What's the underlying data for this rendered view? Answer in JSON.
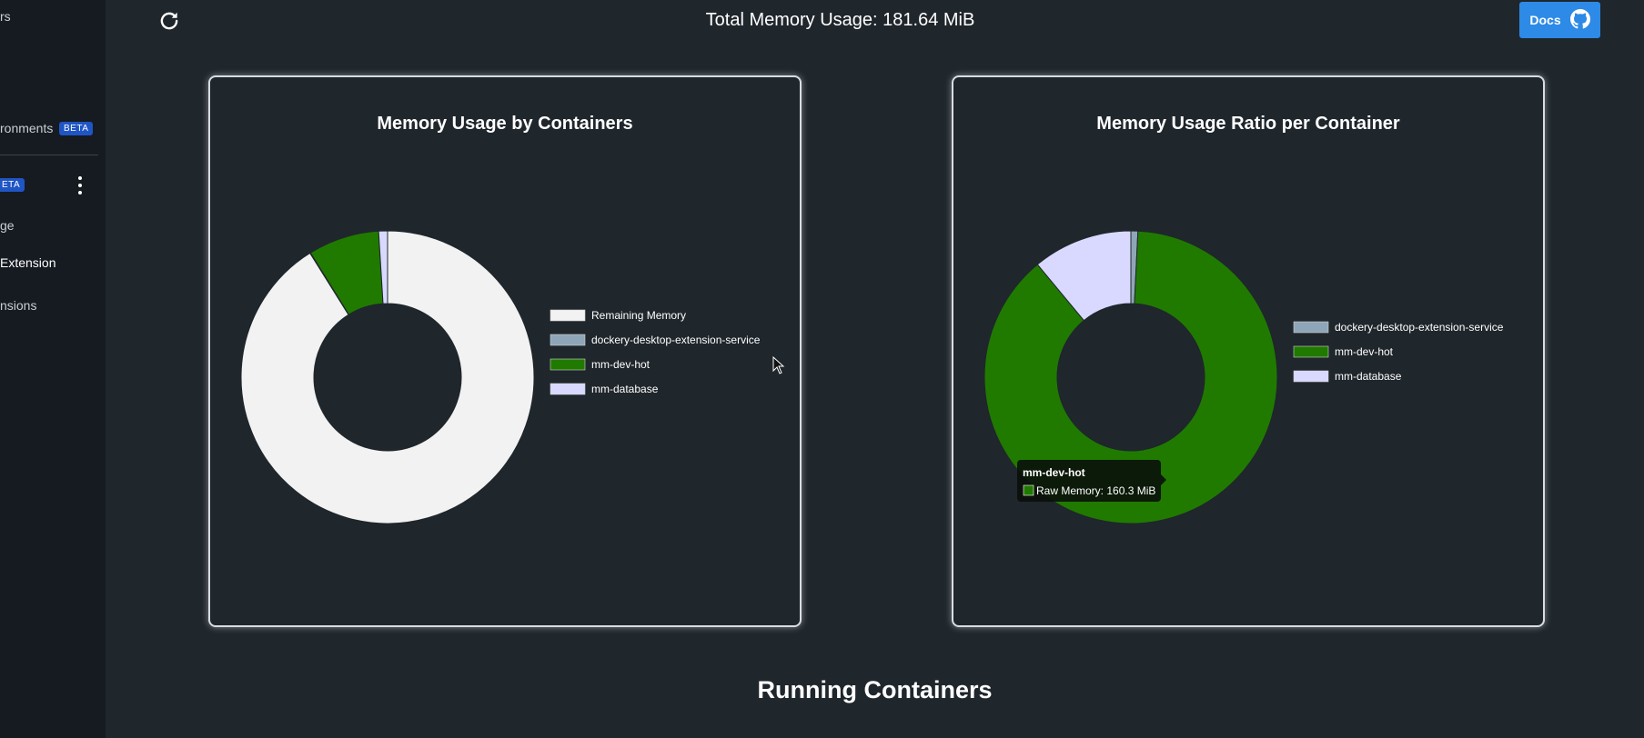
{
  "sidebar": {
    "items": [
      {
        "label": "rs"
      },
      {
        "label": "ronments",
        "badge": "BETA"
      },
      {
        "label": "",
        "badge": "ETA"
      },
      {
        "label": "ge"
      },
      {
        "label": "Extension"
      },
      {
        "label": "nsions"
      }
    ]
  },
  "header": {
    "total_label": "Total Memory Usage: 181.64 MiB",
    "docs_label": "Docs",
    "refresh_icon": "refresh-icon",
    "github_icon": "github-icon"
  },
  "colors": {
    "remaining": "#f2f2f2",
    "extension_service": "#8fa6b8",
    "mm_dev_hot": "#207a00",
    "mm_database": "#d9d9ff",
    "docs_button": "#2d8ae6"
  },
  "chart_data": [
    {
      "type": "pie",
      "title": "Memory Usage by Containers",
      "categories": [
        "Remaining Memory",
        "dockery-desktop-extension-service",
        "mm-dev-hot",
        "mm-database"
      ],
      "values": [
        1863.4,
        1.4,
        160.3,
        20.0
      ],
      "legend_position": "right",
      "donut": true
    },
    {
      "type": "pie",
      "title": "Memory Usage Ratio per Container",
      "categories": [
        "dockery-desktop-extension-service",
        "mm-dev-hot",
        "mm-database"
      ],
      "values": [
        1.4,
        160.3,
        20.0
      ],
      "legend_position": "right",
      "donut": true,
      "tooltip": {
        "title": "mm-dev-hot",
        "label": "Raw Memory: 160.3 MiB"
      }
    }
  ],
  "section": {
    "running_title": "Running Containers"
  }
}
